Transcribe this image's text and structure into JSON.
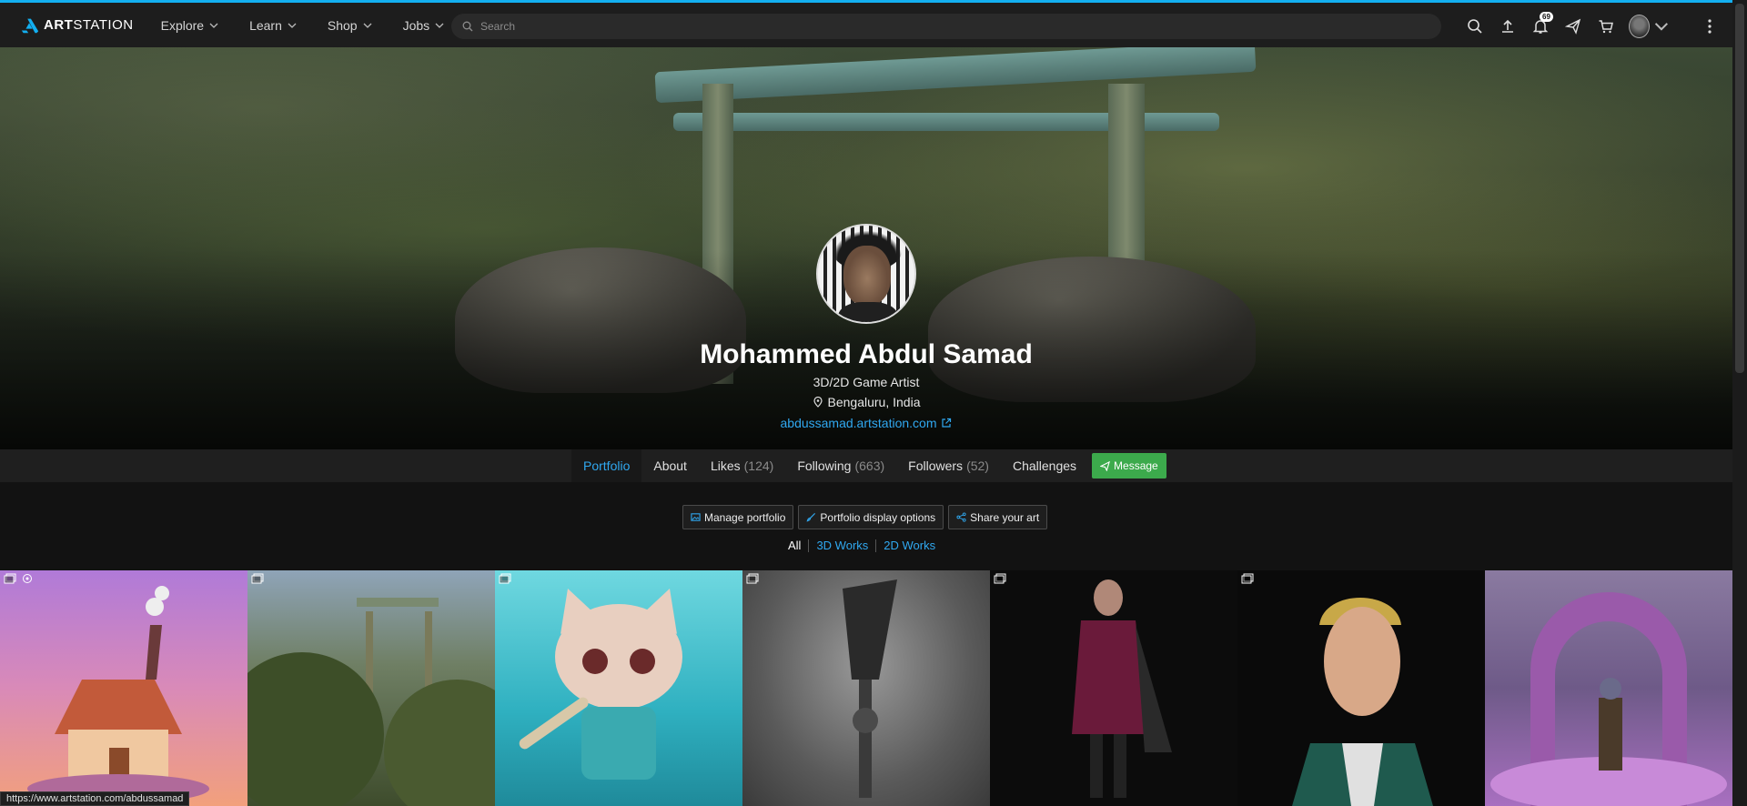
{
  "topbar": {
    "logo_text_bold": "ART",
    "logo_text": "STATION",
    "nav": [
      {
        "label": "Explore"
      },
      {
        "label": "Learn"
      },
      {
        "label": "Shop"
      },
      {
        "label": "Jobs"
      }
    ],
    "search_placeholder": "Search",
    "notifications_count": "69"
  },
  "profile": {
    "name": "Mohammed Abdul Samad",
    "headline": "3D/2D Game Artist",
    "location": "Bengaluru, India",
    "website": "abdussamad.artstation.com"
  },
  "tabs": [
    {
      "label": "Portfolio",
      "count": ""
    },
    {
      "label": "About",
      "count": ""
    },
    {
      "label": "Likes",
      "count": "(124)"
    },
    {
      "label": "Following",
      "count": "(663)"
    },
    {
      "label": "Followers",
      "count": "(52)"
    },
    {
      "label": "Challenges",
      "count": ""
    }
  ],
  "message_label": "Message",
  "actions": {
    "manage": "Manage portfolio",
    "display": "Portfolio display options",
    "share": "Share your art"
  },
  "filters": {
    "all": "All",
    "three_d": "3D Works",
    "two_d": "2D Works"
  },
  "status_url": "https://www.artstation.com/abdussamad",
  "colors": {
    "accent": "#13aff0",
    "link": "#30a8f0",
    "message_green": "#3caa4c"
  }
}
